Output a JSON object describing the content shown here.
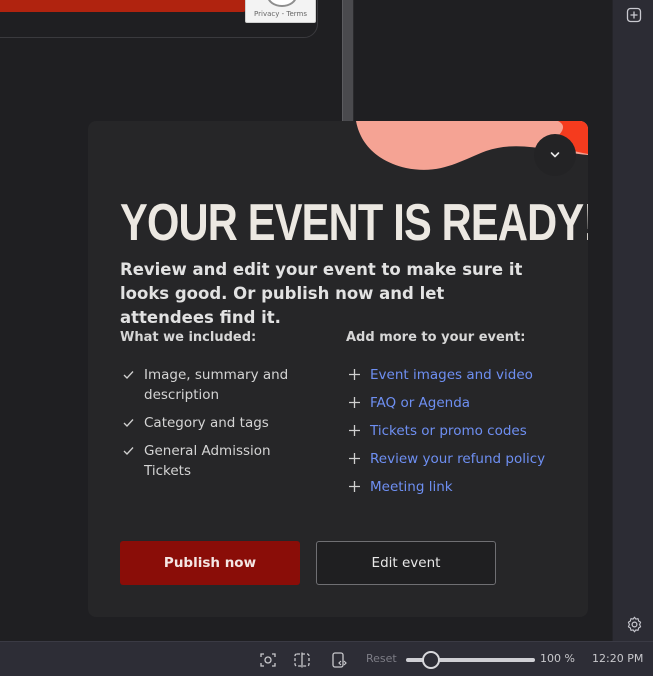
{
  "background": {
    "recaptcha_links": "Privacy - Terms"
  },
  "modal": {
    "title": "YOUR EVENT IS READY!",
    "subtitle": "Review and edit your event to make sure it looks good. Or publish now and let attendees find it.",
    "included_heading": "What we included:",
    "included_items": [
      "Image, summary and description",
      "Category and tags",
      "General Admission Tickets"
    ],
    "more_heading": "Add more to your event:",
    "more_items": [
      "Event images and video",
      "FAQ or Agenda",
      "Tickets or promo codes",
      "Review your refund policy",
      "Meeting link"
    ],
    "publish_label": "Publish now",
    "edit_label": "Edit event",
    "colors": {
      "accent_blob": "#f5a394",
      "accent_red": "#f53b1e",
      "link": "#6e8ff2",
      "publish_bg": "#8a0d08"
    }
  },
  "status_bar": {
    "reset_label": "Reset",
    "zoom_level": "100 %",
    "zoom_fraction": 0.19,
    "time": "12:20 PM"
  }
}
